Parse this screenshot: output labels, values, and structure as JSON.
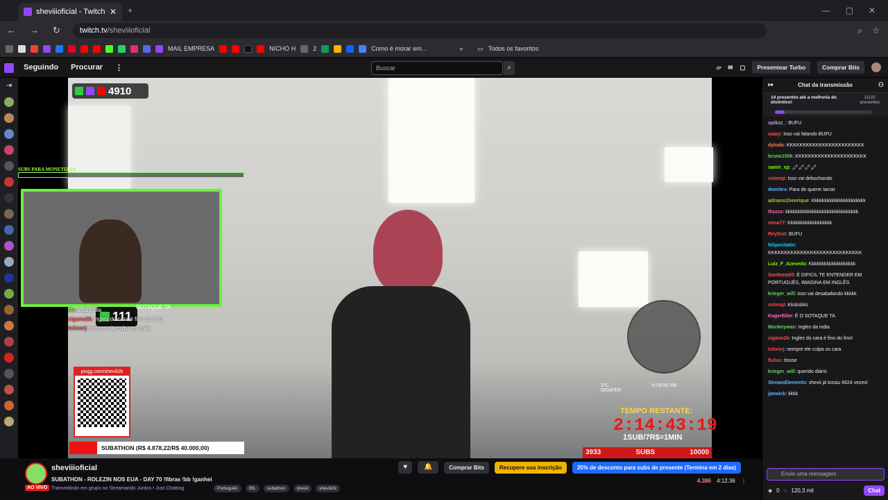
{
  "browser": {
    "tab_title": "sheviiioficial - Twitch",
    "url_host": "twitch.tv",
    "url_path": "/sheviiioficial",
    "bookmarks": [
      "MAIL EMPRESA",
      "NICHO H",
      "2",
      "Como é morar em...",
      "Todos os favoritos"
    ]
  },
  "twitch": {
    "nav": [
      "Seguindo",
      "Procurar"
    ],
    "search_placeholder": "Buscar",
    "turbo": "Presentear Turbo",
    "bits": "Comprar Bits"
  },
  "overlay": {
    "counter": "4910",
    "subs_label": "SUBS PARA MONETIZAR",
    "k_count": "111",
    "sotaque": "SOTAQUE TA",
    "overlay_chat": [
      {
        "user": "Mo",
        "text": "s da india"
      },
      {
        "user": "cigano2k",
        "text": "Ingles do cara é fino do fino!"
      },
      {
        "user": "txitxorj",
        "text": "sempre ele culpa os cara"
      }
    ],
    "qr_header": "pixgg.com/sheviii2k",
    "subathon": "SUBATHON (R$ 4.878,22/R$ 40.000,00)",
    "temperature": "3°C",
    "clock": "6:29:56 PM",
    "location": "DRAPER",
    "tempo_label": "TEMPO RESTANTE:",
    "timer": "2:14:43:19",
    "rate": "1SUB/7R$=1MIN",
    "subs_current": "3933",
    "subs_label2": "SUBS",
    "subs_goal": "10000"
  },
  "chat": {
    "header": "Chat da transmissão",
    "gift_text": "14 presentes até a melhoria do distintivo!",
    "gift_count": "11/25",
    "gift_sub": "presentes",
    "gift_progress": 0.1,
    "messages": [
      {
        "user": "opikzz_",
        "color": "#b9a3e3",
        "text": "BUFU"
      },
      {
        "user": "uaipy",
        "color": "#ff4a4a",
        "text": "Isso vai falando BUFU"
      },
      {
        "user": "dyludo",
        "color": "#ff7f50",
        "text": "KKKKKKKKKKKKKKKKKKKKKKKK"
      },
      {
        "user": "bruno150k",
        "color": "#5fd35f",
        "text": "KKKKKKKKKKKKKKKKKKKKKK"
      },
      {
        "user": "samir_xp",
        "color": "#7cfc00",
        "text": "🖍🖍🖍🖍"
      },
      {
        "user": "svtenqi",
        "color": "#ff4a4a",
        "text": "Isso vai debochando"
      },
      {
        "user": "deeebrx",
        "color": "#5cb3ff",
        "text": "Para de querer lacrar"
      },
      {
        "user": "adriano1henrique",
        "color": "#9acd32",
        "text": "Kkkkkkkkkkkkkkkkkkkkkk"
      },
      {
        "user": "thzzzo",
        "color": "#ff69b4",
        "text": "kkkkkkkkkkkkkkkkkkkkkkkkkkkkkk"
      },
      {
        "user": "vtma77",
        "color": "#ff4a4a",
        "text": "Kkkkkkkkkkkkkkkkkk"
      },
      {
        "user": "ReyDist",
        "color": "#ff4a4a",
        "text": "BUFU"
      },
      {
        "user": "felipecitatin",
        "color": "#00d4ff",
        "text": "KKKKKKKKKKKKKKKKKKKKKKKKKKKKK"
      },
      {
        "user": "Luiz_F_Azevedo",
        "color": "#7cfc00",
        "text": "Kkkkkkkkkkkkkkkkkkk"
      },
      {
        "user": "Santtana95",
        "color": "#ff4a4a",
        "text": "É DIFICIL TE ENTENDER EM PORTUGUÊS, IMAGINA EM INGLÊS"
      },
      {
        "user": "krieger_will",
        "color": "#5fd35f",
        "text": "isso vai desabafando kkkkk"
      },
      {
        "user": "svtenqi",
        "color": "#ff4a4a",
        "text": "Kkskskks"
      },
      {
        "user": "KagerBibe",
        "color": "#ff69b4",
        "text": "É O SOTAQUE TA"
      },
      {
        "user": "Monkeywan",
        "color": "#5fd35f",
        "text": "Ingles da india"
      },
      {
        "user": "cigano2k",
        "color": "#ff4a4a",
        "text": "Ingles do cara é fino do fino!"
      },
      {
        "user": "txitxorj",
        "color": "#ff4a4a",
        "text": "sempre ele culpa os cara"
      },
      {
        "user": "fiuluu",
        "color": "#ff4a4a",
        "text": "Itosse"
      },
      {
        "user": "krieger_will",
        "color": "#5fd35f",
        "text": "querido diário"
      },
      {
        "user": "StreamElements",
        "color": "#5cb3ff",
        "text": "shevii já tossiu 6624 vezes!"
      },
      {
        "user": "janwick",
        "color": "#5cb3ff",
        "text": "kkkk"
      }
    ],
    "input_placeholder": "Envie uma mensagem",
    "points": "0",
    "points2": "120,3 mil",
    "chat_button": "Chat"
  },
  "stream": {
    "channel": "sheviiioficial",
    "live": "AO VIVO",
    "title": "SUBATHON - ROLEZIN NOS EUA - DAY 70 !fibras !bb !ganhei",
    "category": "Transmitindo em grupo no Streamando Juntos • Just Chatting",
    "tags": [
      "Português",
      "IRL",
      "subathon",
      "shevii",
      "sheviii2k"
    ],
    "buy_bits": "Comprar Bits",
    "recover": "Recupere sua inscrição",
    "promo": "35% de desconto para subs de presente (Termina em 2 dias)",
    "viewers": "4.386",
    "uptime": "4:12:36"
  }
}
